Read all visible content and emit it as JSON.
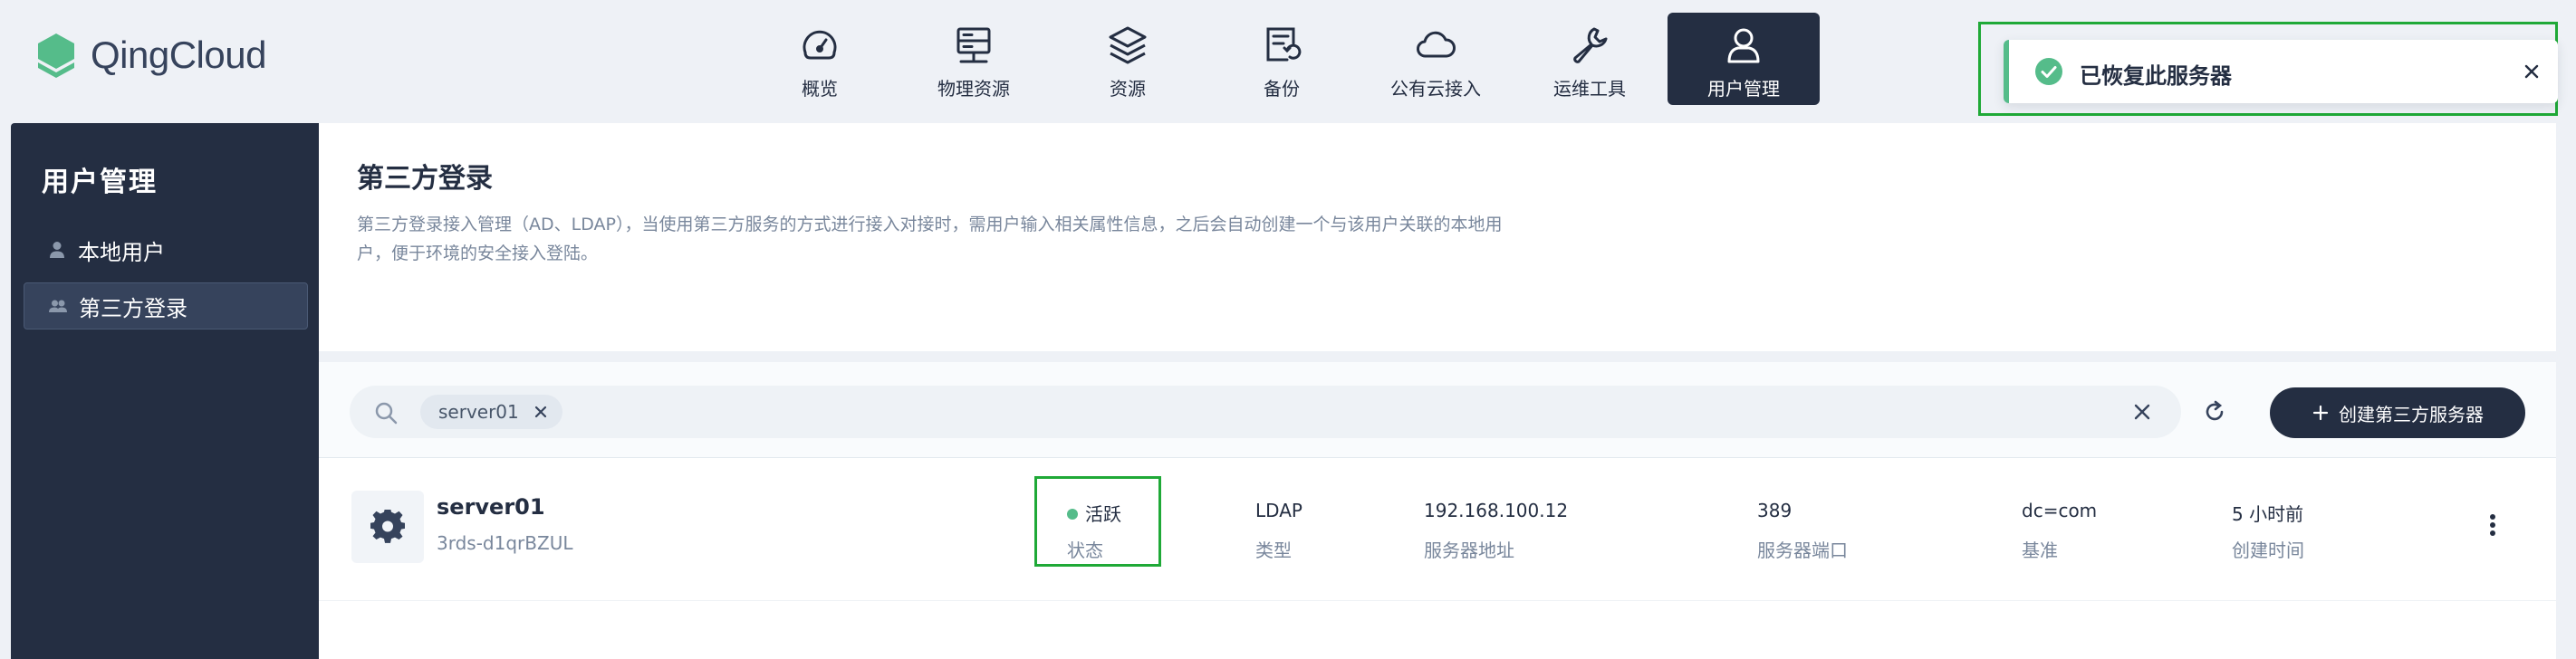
{
  "brand": {
    "name": "QingCloud"
  },
  "nav": {
    "items": [
      {
        "label": "概览",
        "icon": "dashboard-gauge-icon"
      },
      {
        "label": "物理资源",
        "icon": "server-rack-icon"
      },
      {
        "label": "资源",
        "icon": "layers-icon"
      },
      {
        "label": "备份",
        "icon": "backup-document-icon"
      },
      {
        "label": "公有云接入",
        "icon": "cloud-icon"
      },
      {
        "label": "运维工具",
        "icon": "wrench-icon"
      },
      {
        "label": "用户管理",
        "icon": "user-icon",
        "active": true
      }
    ]
  },
  "sidebar": {
    "title": "用户管理",
    "items": [
      {
        "label": "本地用户",
        "icon": "user-icon"
      },
      {
        "label": "第三方登录",
        "icon": "users-icon",
        "active": true
      }
    ]
  },
  "header": {
    "title": "第三方登录",
    "description": "第三方登录接入管理（AD、LDAP），当使用第三方服务的方式进行接入对接时，需用户输入相关属性信息，之后会自动创建一个与该用户关联的本地用户，便于环境的安全接入登陆。"
  },
  "toolbar": {
    "search_tag": "server01",
    "create_label": "创建第三方服务器"
  },
  "rows": [
    {
      "name": "server01",
      "id": "3rds-d1qrBZUL",
      "status": {
        "value": "活跃",
        "label": "状态"
      },
      "type": {
        "value": "LDAP",
        "label": "类型"
      },
      "address": {
        "value": "192.168.100.12",
        "label": "服务器地址"
      },
      "port": {
        "value": "389",
        "label": "服务器端口"
      },
      "base": {
        "value": "dc=com",
        "label": "基准"
      },
      "created": {
        "value": "5 小时前",
        "label": "创建时间"
      }
    }
  ],
  "toast": {
    "message": "已恢复此服务器"
  },
  "colors": {
    "primary_dark": "#242e42",
    "success_green": "#55bc8a",
    "highlight_green": "#1fa937",
    "page_bg": "#eef1f6"
  }
}
